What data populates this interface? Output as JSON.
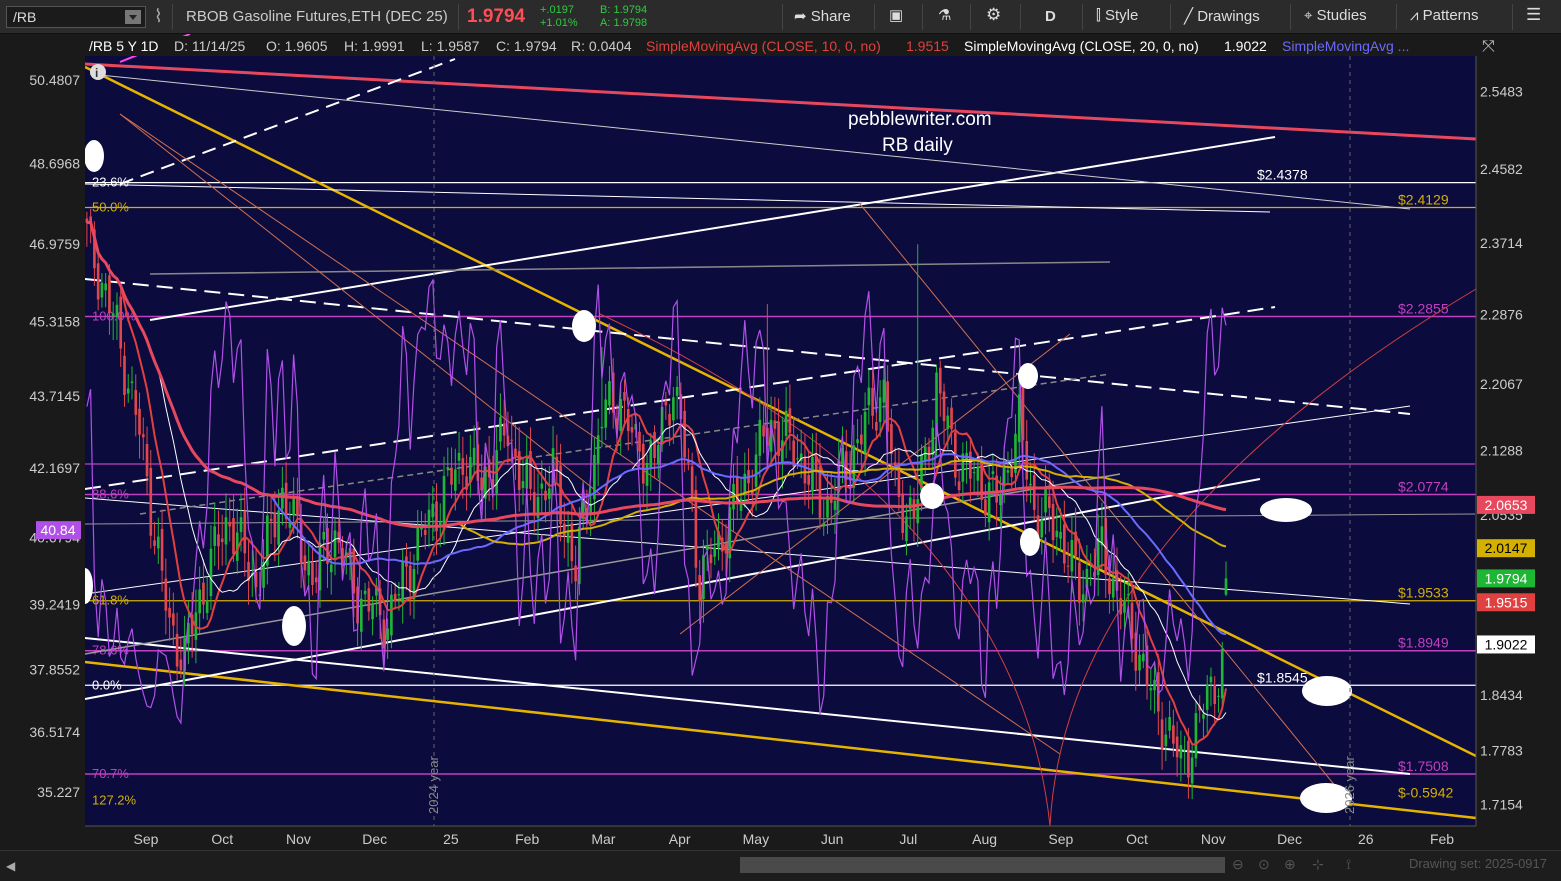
{
  "toolbar": {
    "symbol": "/RB",
    "description": "RBOB Gasoline Futures,ETH (DEC 25)",
    "last": "1.9794",
    "change": "+.0197",
    "change_pct": "+1.01%",
    "bid": "B: 1.9794",
    "ask": "A: 1.9798",
    "share": "Share",
    "aggregation": "D",
    "style": "Style",
    "drawings": "Drawings",
    "studies": "Studies",
    "patterns": "Patterns"
  },
  "header": {
    "label": "/RB 5 Y 1D",
    "date": "D: 11/14/25",
    "open": "O: 1.9605",
    "high": "H: 1.9991",
    "low": "L: 1.9587",
    "close": "C: 1.9794",
    "range": "R: 0.0404",
    "sma10": "SimpleMovingAvg (CLOSE, 10, 0, no)",
    "sma10_val": "1.9515",
    "sma20": "SimpleMovingAvg (CLOSE, 20, 0, no)",
    "sma20_val": "1.9022",
    "sma3": "SimpleMovingAvg ..."
  },
  "watermark": {
    "line1": "pebblewriter.com",
    "line2": "RB daily"
  },
  "status": "Drawing set: 2025-0917",
  "colors": {
    "background": "#0b0b3d",
    "up": "#1fb535",
    "down": "#e0474c",
    "sma_red": "#e04040",
    "sma_blue": "#6a6aff",
    "sma_gold": "#d4b000",
    "sma200": "#e8485e",
    "oscillator": "#b150e8",
    "fib_gold": "#d4b000",
    "fib_violet": "#c040c0",
    "trend_gold": "#e6b400"
  },
  "chart_data": {
    "type": "candlestick",
    "title": "/RB 5 Y 1D",
    "x_ticks": [
      "Sep",
      "Oct",
      "Nov",
      "Dec",
      "25",
      "Feb",
      "Mar",
      "Apr",
      "May",
      "Jun",
      "Jul",
      "Aug",
      "Sep",
      "Oct",
      "Nov",
      "Dec",
      "26",
      "Feb"
    ],
    "year_markers": [
      "2024 year",
      "2026 year"
    ],
    "y_ticks_right": [
      "2.5483",
      "2.4582",
      "2.3714",
      "2.2876",
      "2.2067",
      "2.1288",
      "2.0535",
      "1.8434",
      "1.7783",
      "1.7154"
    ],
    "y_ticks_left": [
      "50.4807",
      "48.6968",
      "46.9759",
      "45.3158",
      "43.7145",
      "42.1697",
      "40.6794",
      "39.2419",
      "37.8552",
      "36.5174",
      "35.227"
    ],
    "ylim": [
      1.69,
      2.59
    ],
    "osc_ylim": [
      34.5,
      51.0
    ],
    "osc_marker": "40.84",
    "price_markers": [
      {
        "label": "2.0653",
        "value": 2.0653,
        "color": "#e8485e"
      },
      {
        "label": "2.0147",
        "value": 2.0147,
        "color": "#d4b000"
      },
      {
        "label": "1.9794",
        "value": 1.9794,
        "color": "#1fb535"
      },
      {
        "label": "1.9515",
        "value": 1.9515,
        "color": "#e04040"
      },
      {
        "label": "1.9022",
        "value": 1.9022,
        "color": "#ffffff"
      }
    ],
    "fib_levels": [
      {
        "label": "23.6%",
        "value": 2.442,
        "price_label": "$2.4378",
        "color": "#ffffff"
      },
      {
        "label": "50.0%",
        "value": 2.4129,
        "price_label": "$2.4129",
        "color": "#d4b000"
      },
      {
        "label": "100.0%",
        "value": 2.2855,
        "price_label": "$2.2855",
        "color": "#c040c0"
      },
      {
        "label": "88.6%",
        "value": 2.0774,
        "price_label": "$2.0774",
        "color": "#c040c0"
      },
      {
        "label": "61.8%",
        "value": 1.9533,
        "price_label": "$1.9533",
        "color": "#d4b000"
      },
      {
        "label": "78.6%",
        "value": 1.8949,
        "price_label": "$1.8949",
        "color": "#c040c0"
      },
      {
        "label": "0.0%",
        "value": 1.8545,
        "price_label": "$1.8545",
        "color": "#ffffff"
      },
      {
        "label": "70.7%",
        "value": 1.7508,
        "price_label": "$1.7508",
        "color": "#c040c0"
      },
      {
        "label": "127.2%",
        "value": 1.72,
        "price_label": "$-0.5942",
        "color": "#d4b000"
      }
    ],
    "candle_count": 304,
    "series": [
      {
        "name": "SimpleMovingAvg (CLOSE, 10, 0, no)",
        "value": 1.9515
      },
      {
        "name": "SimpleMovingAvg (CLOSE, 20, 0, no)",
        "value": 1.9022
      }
    ],
    "ohlc_last": {
      "open": 1.9605,
      "high": 1.9991,
      "low": 1.9587,
      "close": 1.9794
    }
  }
}
